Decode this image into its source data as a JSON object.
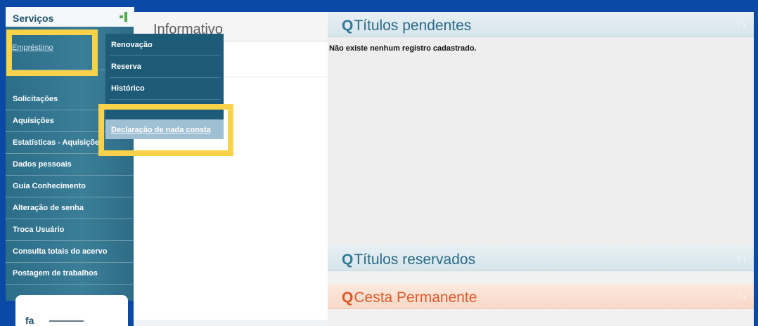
{
  "sidebar": {
    "title": "Serviços",
    "items": [
      {
        "label": "Empréstimo"
      },
      {
        "label": "Solicitações"
      },
      {
        "label": "Aquisições"
      },
      {
        "label": "Estatísticas - Aquisições"
      },
      {
        "label": "Dados pessoais"
      },
      {
        "label": "Guia Conhecimento"
      },
      {
        "label": "Alteração de senha"
      },
      {
        "label": "Troca Usuário"
      },
      {
        "label": "Consulta totais do acervo"
      },
      {
        "label": "Postagem de trabalhos"
      }
    ],
    "logo_mark": "fa"
  },
  "submenu": {
    "items": [
      {
        "label": "Renovação"
      },
      {
        "label": "Reserva"
      },
      {
        "label": "Histórico"
      }
    ],
    "highlighted": "Declaração de nada consta"
  },
  "informativo": {
    "title": "Informativo"
  },
  "panels": {
    "pendentes": {
      "q": "Q",
      "title": "Títulos pendentes",
      "empty_message": "Não existe nenhum registro cadastrado."
    },
    "reservados": {
      "q": "Q",
      "title": "Títulos reservados"
    },
    "cesta": {
      "q": "Q",
      "title": "Cesta Permanente"
    }
  },
  "colors": {
    "background": "#0a49a6",
    "sidebar": "#2c6d88",
    "callout": "#f7d24a",
    "panel_title_blue": "#2a6a86",
    "panel_title_orange": "#e35a2a"
  }
}
